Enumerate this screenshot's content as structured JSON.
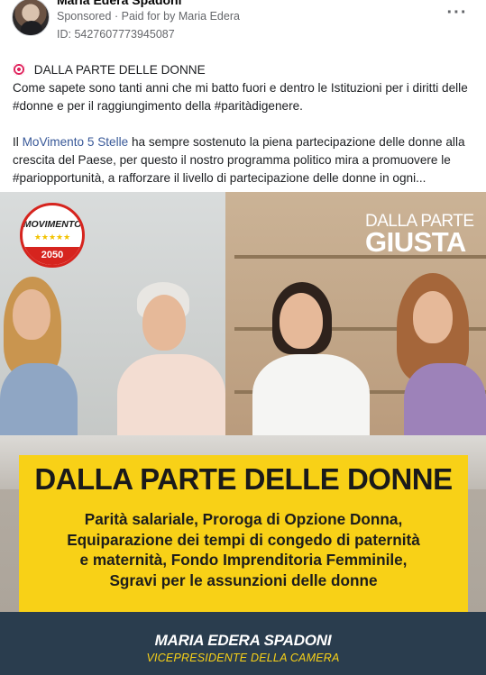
{
  "post": {
    "author": "Maria Edera Spadoni",
    "sponsored": "Sponsored",
    "separator": "·",
    "paid_for_prefix": "Paid for by",
    "paid_for_name": "Maria Edera",
    "ad_id": "ID: 5427607773945087",
    "more_icon": "more-horizontal-icon"
  },
  "text": {
    "line1_title": "DALLA PARTE DELLE DONNE",
    "para1": "Come sapete sono tanti anni che mi batto fuori e dentro le Istituzioni per i diritti delle #donne e per il raggiungimento della #paritàdigenere.",
    "para2_prefix": "Il ",
    "para2_link": "MoVimento 5 Stelle",
    "para2_rest": " ha sempre sostenuto la piena partecipazione delle donne alla crescita del Paese, per questo il nostro programma politico mira a promuovere le #pariopportunità, a rafforzare il livello di partecipazione delle donne in ogni..."
  },
  "creative": {
    "logo": {
      "word": "MOVIMENTO",
      "stars": "★★★★★",
      "year": "2050"
    },
    "slogan_small": "DALLA PARTE",
    "slogan_big": "GIUSTA",
    "headline": "DALLA PARTE DELLE DONNE",
    "policy_lines": [
      "Parità salariale, Proroga di Opzione Donna,",
      "Equiparazione dei tempi di congedo di paternità",
      "e maternità, Fondo Imprenditoria Femminile,",
      "Sgravi per le assunzioni delle donne"
    ],
    "footer_name": "MARIA EDERA SPADONI",
    "footer_role": "VICEPRESIDENTE DELLA CAMERA"
  },
  "colors": {
    "accent_yellow": "#f8d117",
    "footer_navy": "#2a3d4e",
    "m5s_red": "#d6241e",
    "link_blue": "#385898"
  }
}
